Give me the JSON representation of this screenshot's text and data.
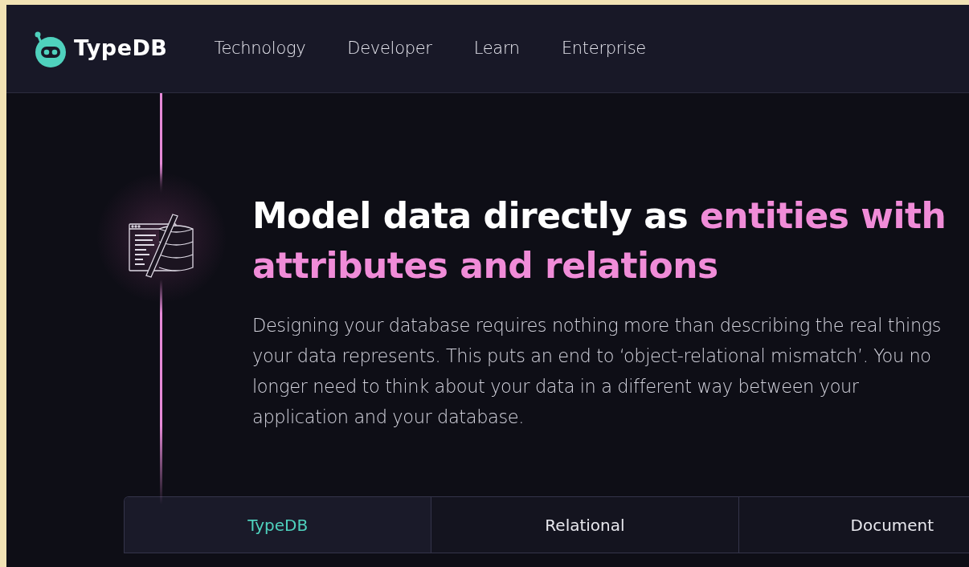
{
  "nav": {
    "logo": "TypeDB",
    "links": [
      "Technology",
      "Developer",
      "Learn",
      "Enterprise"
    ]
  },
  "hero": {
    "title": "Model data directly as",
    "title_highlight": "entities with attributes and relations",
    "body": "Designing your database requires nothing more than describing the real things your data represents. This puts an end to ‘object-relational mismatch’. You no longer need to think about your data in a different way between your application and your database."
  },
  "tabs": [
    {
      "label": "TypeDB",
      "selected": true
    },
    {
      "label": "Relational",
      "selected": false
    },
    {
      "label": "Document",
      "selected": false
    }
  ]
}
